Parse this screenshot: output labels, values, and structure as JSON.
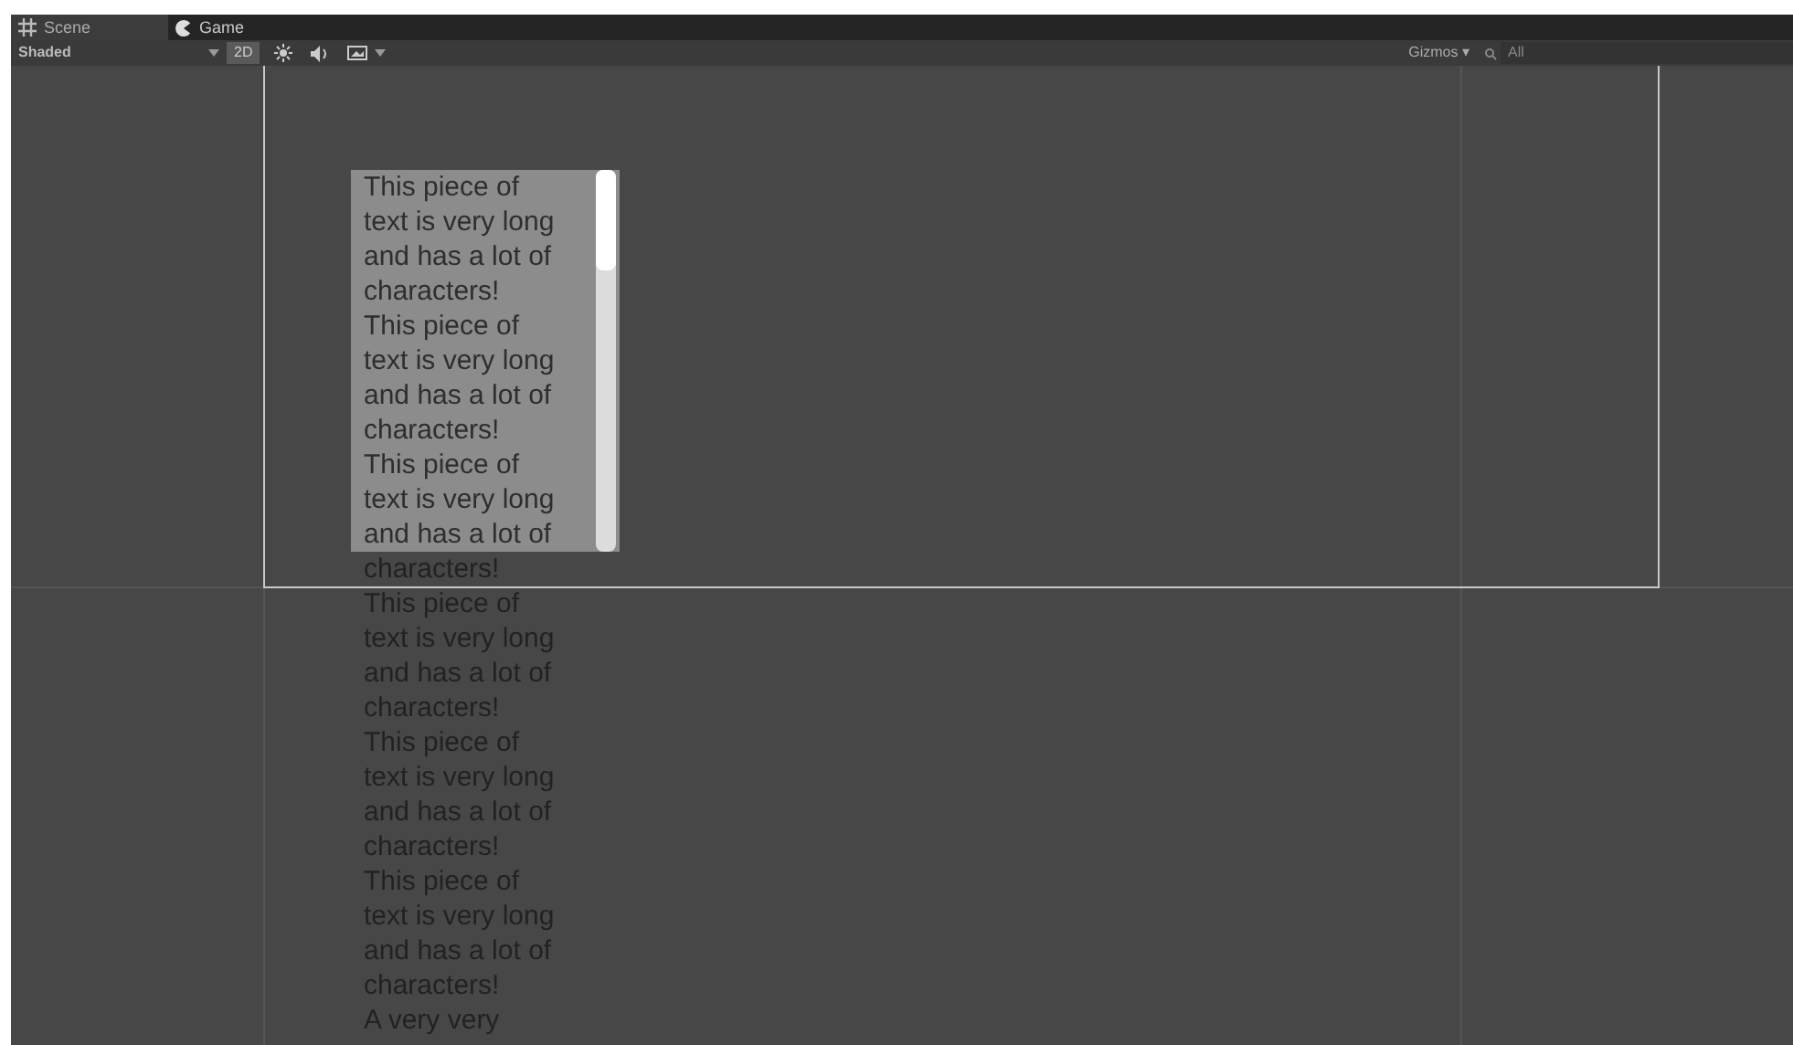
{
  "tabs": [
    {
      "label": "Scene",
      "kind": "scene",
      "selected": true
    },
    {
      "label": "Game",
      "kind": "game",
      "selected": false
    }
  ],
  "toolbar": {
    "draw_mode": "Shaded",
    "mode_2d": {
      "label": "2D",
      "on": true
    },
    "gizmos": "Gizmos",
    "gizmos_caret": "▾",
    "search": {
      "placeholder": "All"
    }
  },
  "scroll_view": {
    "lines_inside": [
      "This piece of",
      "text is very long",
      "and has a lot of",
      "characters!",
      "This piece of",
      "text is very long",
      "and has a lot of",
      "characters!",
      "This piece of",
      "text is very long",
      "and has a lot of"
    ],
    "lines_overflow": [
      "characters!",
      "This piece of",
      "text is very long",
      "and has a lot of",
      "characters!",
      "This piece of",
      "text is very long",
      "and has a lot of",
      "characters!",
      "This piece of",
      "text is very long",
      "and has a lot of",
      "characters!",
      "A very very"
    ]
  }
}
